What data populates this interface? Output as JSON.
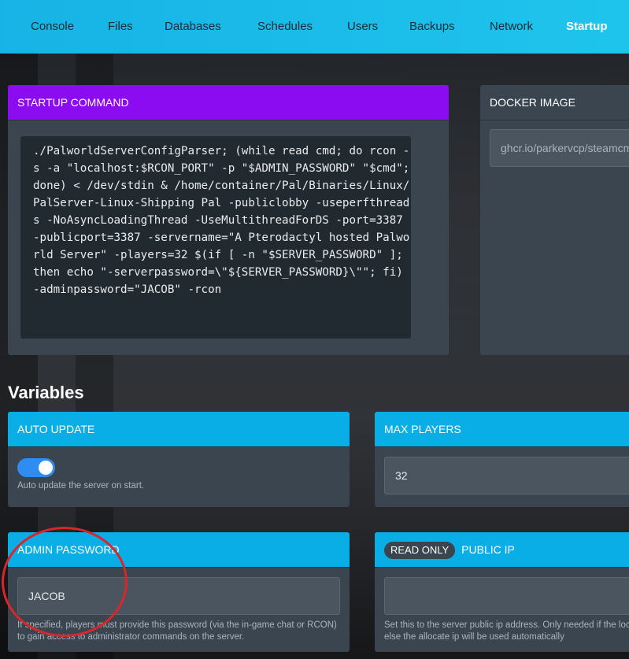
{
  "nav": {
    "tabs": [
      {
        "label": "Console"
      },
      {
        "label": "Files"
      },
      {
        "label": "Databases"
      },
      {
        "label": "Schedules"
      },
      {
        "label": "Users"
      },
      {
        "label": "Backups"
      },
      {
        "label": "Network"
      },
      {
        "label": "Startup"
      }
    ],
    "active_tab": "Startup"
  },
  "startup": {
    "title": "STARTUP COMMAND",
    "command": "./PalworldServerConfigParser; (while read cmd; do rcon -s -a \"localhost:$RCON_PORT\" -p \"$ADMIN_PASSWORD\" \"$cmd\";done) < /dev/stdin & /home/container/Pal/Binaries/Linux/PalServer-Linux-Shipping Pal -publiclobby -useperfthreads -NoAsyncLoadingThread -UseMultithreadForDS -port=3387 -publicport=3387 -servername=\"A Pterodactyl hosted Palworld Server\" -players=32 $(if [ -n \"$SERVER_PASSWORD\" ]; then echo \"-serverpassword=\\\"${SERVER_PASSWORD}\\\"\"; fi) -adminpassword=\"JACOB\" -rcon"
  },
  "docker": {
    "title": "DOCKER IMAGE",
    "value": "ghcr.io/parkervcp/steamcmd"
  },
  "variables": {
    "title": "Variables",
    "auto_update": {
      "title": "AUTO UPDATE",
      "enabled": true,
      "description": "Auto update the server on start."
    },
    "max_players": {
      "title": "MAX PLAYERS",
      "value": "32"
    },
    "admin_password": {
      "title": "ADMIN PASSWORD",
      "value": "JACOB",
      "description": "If specified, players must provide this password (via the in-game chat or RCON) to gain access to administrator commands on the server."
    },
    "public_ip": {
      "badge": "READ ONLY",
      "title": "PUBLIC IP",
      "value": "",
      "description": "Set this to the server public ip address. Only needed if the local ip, else the allocate ip will be used automatically"
    }
  },
  "colors": {
    "nav": "#1fc4ec",
    "startup_header": "#8b0cf0",
    "variable_header": "#0aaee6",
    "card": "#3b4550",
    "annotation": "#d9262a"
  }
}
